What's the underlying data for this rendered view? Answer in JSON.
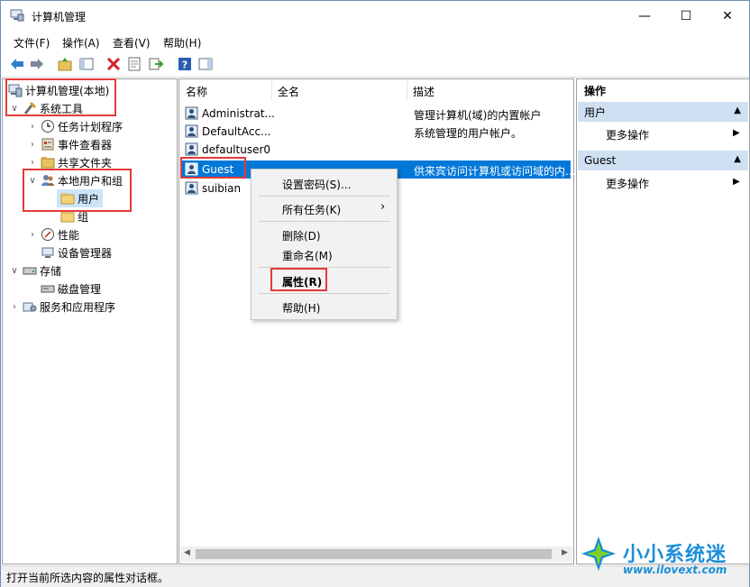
{
  "window": {
    "title": "计算机管理",
    "minimize": "—",
    "maximize": "☐",
    "close": "✕"
  },
  "menubar": [
    "文件(F)",
    "操作(A)",
    "查看(V)",
    "帮助(H)"
  ],
  "toolbar_icons": [
    "back-arrow-icon",
    "forward-arrow-icon",
    "up-folder-icon",
    "show-hide-tree-icon",
    "delete-icon",
    "properties-icon",
    "export-icon",
    "help-icon",
    "action-pane-icon"
  ],
  "tree": {
    "root": "计算机管理(本地)",
    "system_tools": "系统工具",
    "task_scheduler": "任务计划程序",
    "event_viewer": "事件查看器",
    "shared_folders": "共享文件夹",
    "local_users_groups": "本地用户和组",
    "users": "用户",
    "groups": "组",
    "performance": "性能",
    "device_manager": "设备管理器",
    "storage": "存储",
    "disk_management": "磁盘管理",
    "services_apps": "服务和应用程序"
  },
  "list": {
    "columns": [
      "名称",
      "全名",
      "描述"
    ],
    "rows": [
      {
        "name": "Administrat...",
        "fullname": "",
        "desc": "管理计算机(域)的内置帐户"
      },
      {
        "name": "DefaultAcc...",
        "fullname": "",
        "desc": "系统管理的用户帐户。"
      },
      {
        "name": "defaultuser0",
        "fullname": "",
        "desc": ""
      },
      {
        "name": "Guest",
        "fullname": "",
        "desc": "供来宾访问计算机或访问域的内..."
      },
      {
        "name": "suibian",
        "fullname": "",
        "desc": ""
      }
    ]
  },
  "context_menu": {
    "set_password": "设置密码(S)...",
    "all_tasks": "所有任务(K)",
    "all_tasks_arrow": "›",
    "delete": "删除(D)",
    "rename": "重命名(M)",
    "properties": "属性(R)",
    "help": "帮助(H)"
  },
  "actions": {
    "header": "操作",
    "section1": "用户",
    "section1_more": "更多操作",
    "section2": "Guest",
    "section2_more": "更多操作",
    "collapse": "▲",
    "more_arrow": "▶"
  },
  "status": "打开当前所选内容的属性对话框。",
  "watermark": {
    "brand": "小小系统迷",
    "url": "www.ilovext.com"
  },
  "colors": {
    "selection": "#0078d7",
    "highlight_box": "#e33a3a",
    "action_header": "#cfe0f3",
    "watermark_blue": "#1a8fd8"
  }
}
